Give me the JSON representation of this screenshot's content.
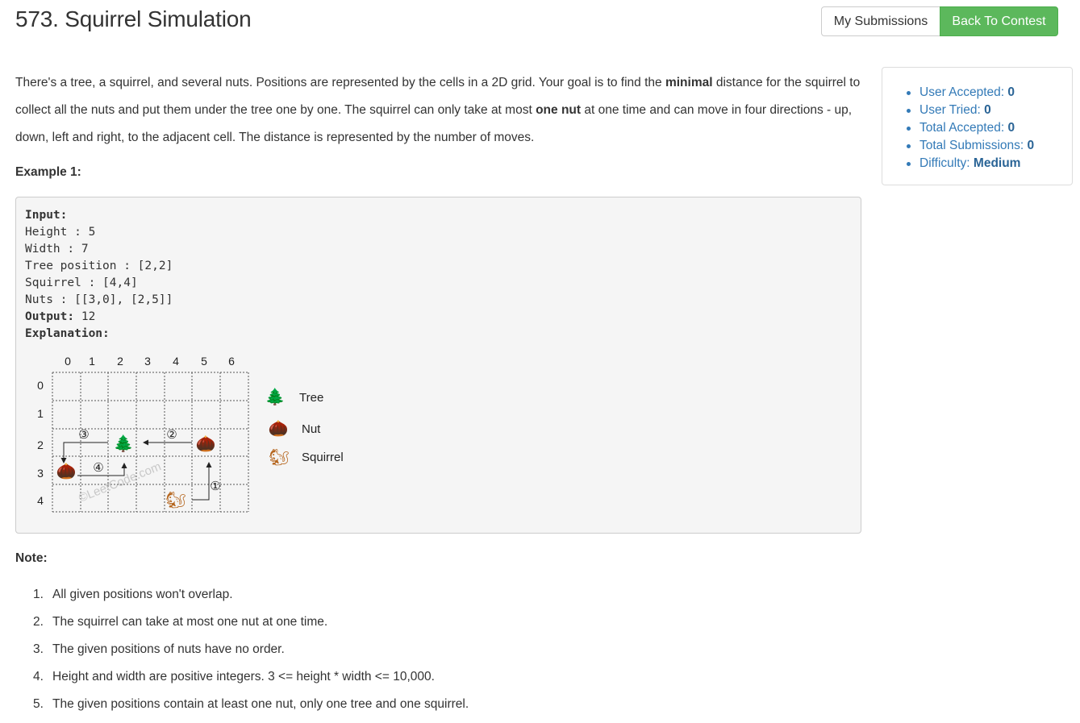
{
  "header": {
    "title": "573. Squirrel Simulation",
    "my_submissions_label": "My Submissions",
    "back_to_contest_label": "Back To Contest"
  },
  "description": {
    "p1_a": "There's a tree, a squirrel, and several nuts. Positions are represented by the cells in a 2D grid. Your goal is to find the ",
    "p1_bold1": "minimal",
    "p1_b": " distance for the squirrel to collect all the nuts and put them under the tree one by one. The squirrel can only take at most ",
    "p1_bold2": "one nut",
    "p1_c": " at one time and can move in four directions - up, down, left and right, to the adjacent cell. The distance is represented by the number of moves."
  },
  "example": {
    "title": "Example 1:",
    "input_label": "Input:",
    "height_line": "Height : 5",
    "width_line": "Width : 7",
    "tree_line": "Tree position : [2,2]",
    "squirrel_line": "Squirrel : [4,4]",
    "nuts_line": "Nuts : [[3,0], [2,5]]",
    "output_label": "Output:",
    "output_value": " 12",
    "explanation_label": "Explanation:"
  },
  "diagram": {
    "col_labels": [
      "0",
      "1",
      "2",
      "3",
      "4",
      "5",
      "6"
    ],
    "row_labels": [
      "0",
      "1",
      "2",
      "3",
      "4"
    ],
    "step_labels": [
      "①",
      "②",
      "③",
      "④"
    ],
    "watermark": "©LeetCode.com",
    "legend": {
      "tree": "Tree",
      "nut": "Nut",
      "squirrel": "Squirrel"
    },
    "icons": {
      "tree": "🌲",
      "nut": "🌰",
      "squirrel": "🐿"
    }
  },
  "note": {
    "title": "Note:",
    "items": [
      "All given positions won't overlap.",
      "The squirrel can take at most one nut at one time.",
      "The given positions of nuts have no order.",
      "Height and width are positive integers. 3 <= height * width <= 10,000.",
      "The given positions contain at least one nut, only one tree and one squirrel."
    ]
  },
  "stats": {
    "user_accepted_label": "User Accepted:",
    "user_accepted_value": "0",
    "user_tried_label": "User Tried:",
    "user_tried_value": "0",
    "total_accepted_label": "Total Accepted:",
    "total_accepted_value": "0",
    "total_submissions_label": "Total Submissions:",
    "total_submissions_value": "0",
    "difficulty_label": "Difficulty:",
    "difficulty_value": "Medium"
  },
  "colors": {
    "success": "#5cb85c",
    "link": "#337ab7",
    "text": "#333333",
    "pre_background": "#f5f5f5"
  }
}
